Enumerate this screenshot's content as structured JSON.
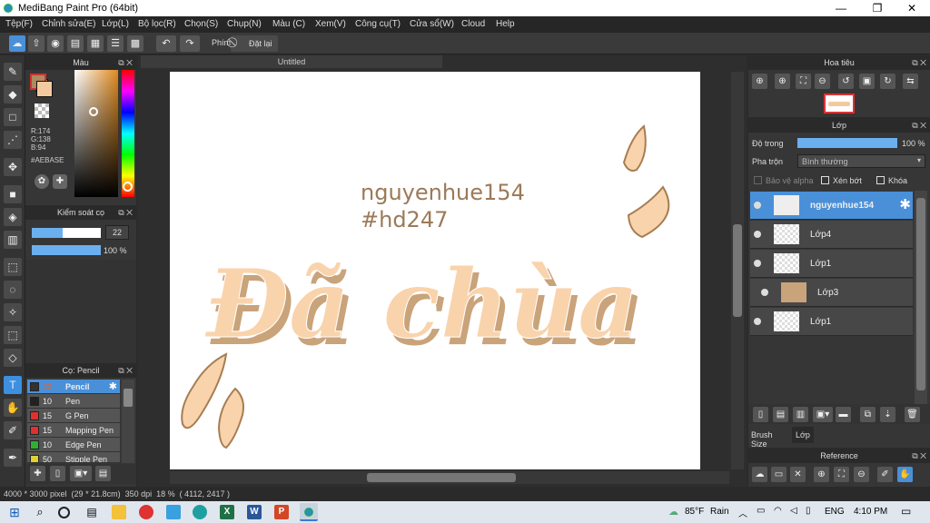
{
  "window": {
    "title": "MediBang Paint Pro (64bit)",
    "minimize": "—",
    "maximize": "❐",
    "close": "✕"
  },
  "menu": [
    "Tệp(F)",
    "Chỉnh sửa(E)",
    "Lớp(L)",
    "Bộ lọc(R)",
    "Chọn(S)",
    "Chụp(N)",
    "Màu (C)",
    "Xem(V)",
    "Công cụ(T)",
    "Cửa sổ(W)",
    "Cloud",
    "Help"
  ],
  "toolbar": {
    "shortcut_label": "Phím",
    "reset_label": "Đặt lại"
  },
  "color_panel": {
    "title": "Màu",
    "r": "R:174",
    "g": "G:138",
    "b": "B:94",
    "hex": "#AEBASE",
    "main_color": "#AE8A5E",
    "sub_color": "#F5C9A0"
  },
  "brush_control": {
    "title": "Kiểm soát cọ",
    "size": "22",
    "opacity": "100 %"
  },
  "brush_panel": {
    "title": "Cọ: Pencil",
    "items": [
      {
        "size": "22",
        "name": "Pencil",
        "color": "#333333"
      },
      {
        "size": "10",
        "name": "Pen",
        "color": "#222222"
      },
      {
        "size": "15",
        "name": "G Pen",
        "color": "#e03030"
      },
      {
        "size": "15",
        "name": "Mapping Pen",
        "color": "#e03030"
      },
      {
        "size": "10",
        "name": "Edge Pen",
        "color": "#30b030"
      },
      {
        "size": "50",
        "name": "Stipple Pen",
        "color": "#e0d030"
      }
    ]
  },
  "canvas": {
    "tab_title": "Untitled",
    "text_line1": "nguyenhue154",
    "text_line2": "#hd247",
    "lettering": "Đã chùa",
    "lettering_color": "#F9D3AB",
    "shadow_color": "#C9A37A"
  },
  "navigator": {
    "title": "Hoa tiêu"
  },
  "layer_panel": {
    "title": "Lớp",
    "opacity_label": "Độ trong",
    "opacity_value": "100 %",
    "blend_label": "Pha trộn",
    "blend_value": "Bình thường",
    "protect_alpha": "Bảo vệ alpha",
    "clipping": "Xén bớt",
    "lock": "Khóa",
    "layers": [
      "nguyenhue154",
      "Lớp4",
      "Lớp1",
      "Lớp3",
      "Lớp1"
    ]
  },
  "bottom_tabs": [
    "Brush Size",
    "Lớp"
  ],
  "reference": {
    "title": "Reference"
  },
  "status": {
    "text": "4000 * 3000 pixel  (29 * 21.8cm)  350 dpi  18 %  ( 4112, 2417 )"
  },
  "taskbar": {
    "weather_temp": "85°F",
    "weather_text": "Rain",
    "lang": "ENG",
    "time": "4:10 PM"
  }
}
